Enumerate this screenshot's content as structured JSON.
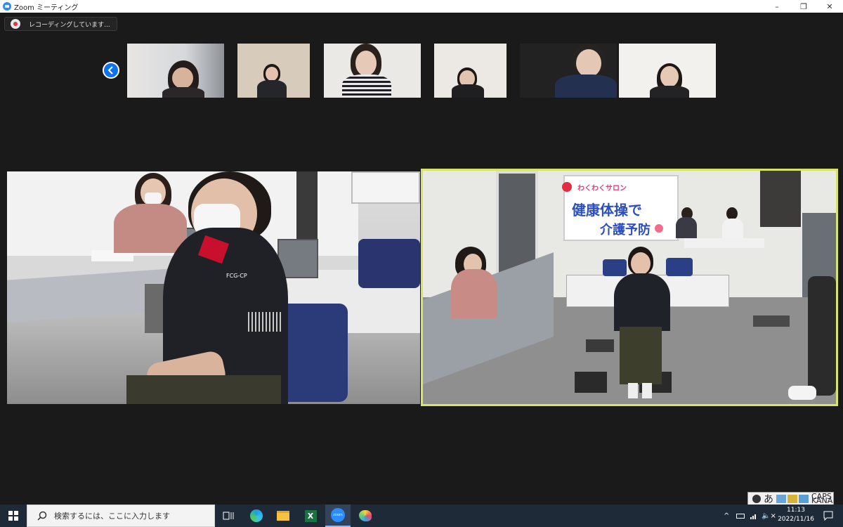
{
  "window": {
    "title": "Zoom ミーティング",
    "minimize": "–",
    "maximize": "❐",
    "close": "✕"
  },
  "recording": {
    "label": "レコーディングしています..."
  },
  "gallery": {
    "prev_button_icon": "chevron-left-icon"
  },
  "speaker_tile": {
    "shirt_logo": "FCG-CP"
  },
  "active_tile": {
    "banner_top": "わくわくサロン",
    "banner_line1": "健康体操で",
    "banner_line2": "介護予防",
    "active_border_color": "#d8e36a"
  },
  "ime": {
    "mode": "あ",
    "caps": "CAPS",
    "kana": "KANA"
  },
  "taskbar": {
    "search_placeholder": "検索するには、ここに入力します",
    "apps": [
      "task-view",
      "edge",
      "file-explorer",
      "excel",
      "zoom",
      "paint"
    ],
    "zoom_label": "zoom",
    "excel_label": "X",
    "tray_caret": "^",
    "volume": "🔈×",
    "time": "11:13",
    "date": "2022/11/16",
    "notification_icon": "notification-icon"
  }
}
